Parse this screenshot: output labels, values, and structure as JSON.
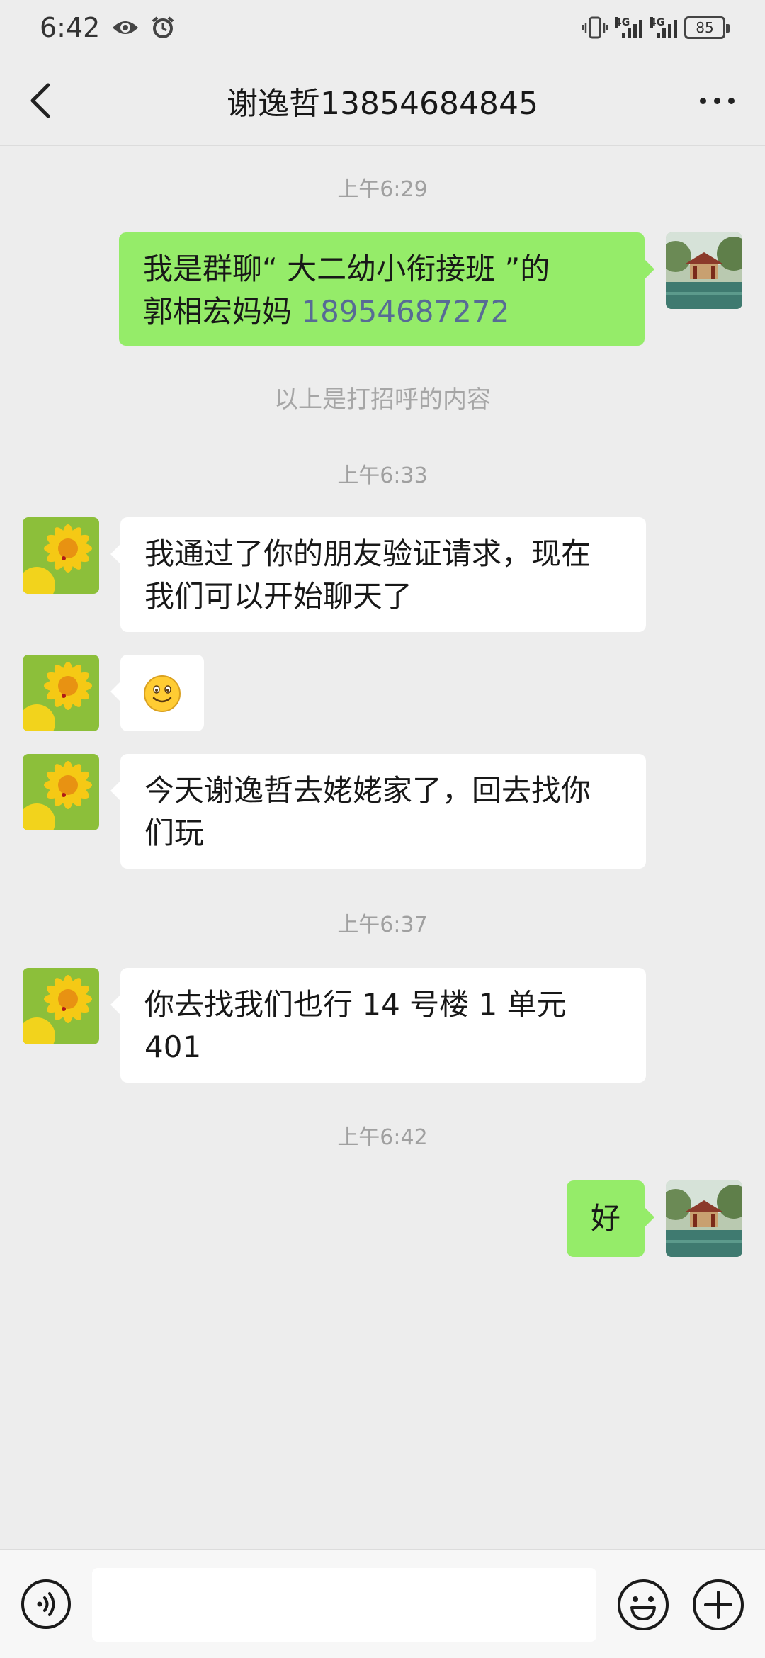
{
  "status_bar": {
    "time": "6:42",
    "network_1": "4G",
    "network_2": "4G",
    "battery": "85"
  },
  "header": {
    "title": "谢逸哲13854684845"
  },
  "messages": {
    "ts1": "上午6:29",
    "m1_line1": "我是群聊“ 大二幼小衔接班 ”的",
    "m1_line2_text": "郭相宏妈妈 ",
    "m1_phone": "18954687272",
    "note": "以上是打招呼的内容",
    "ts2": "上午6:33",
    "m2_line1": "我通过了你的朋友验证请求，现在",
    "m2_line2": "我们可以开始聊天了",
    "m4_line1": "今天谢逸哲去姥姥家了，回去找你",
    "m4_line2": "们玩",
    "ts3": "上午6:37",
    "m5_line1": "你去找我们也行 14 号楼 1 单元",
    "m5_line2": "401",
    "ts4": "上午6:42",
    "m6": "好"
  },
  "colors": {
    "background": "#ededed",
    "bubble_out": "#95ec69",
    "bubble_in": "#ffffff",
    "link": "#576b95"
  },
  "icons": [
    "back-icon",
    "more-icon",
    "eye-icon",
    "alarm-icon",
    "vibrate-icon",
    "signal-icon",
    "battery-icon",
    "voice-icon",
    "emoji-icon",
    "plus-icon",
    "smile-emoji"
  ]
}
